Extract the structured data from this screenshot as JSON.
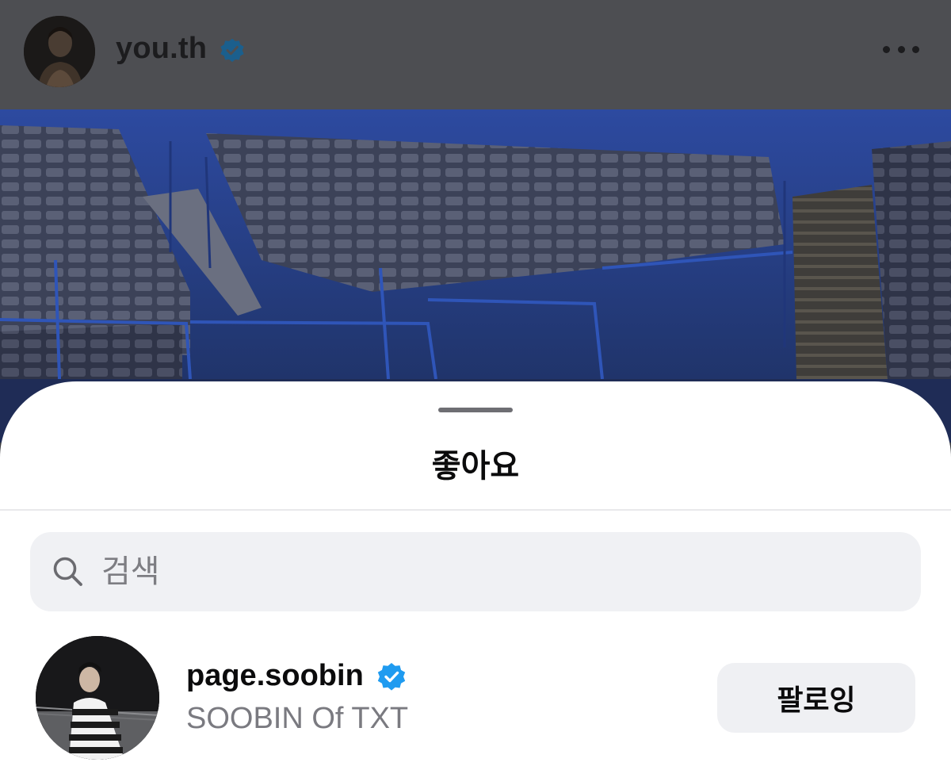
{
  "post": {
    "username": "you.th",
    "verified_icon": "verified-badge-icon",
    "more_icon": "more-horizontal-icon"
  },
  "sheet": {
    "title": "좋아요",
    "search": {
      "placeholder": "검색",
      "value": ""
    },
    "items": [
      {
        "username": "page.soobin",
        "full_name": "SOOBIN Of TXT",
        "verified": true,
        "button_label": "팔로잉"
      }
    ]
  },
  "colors": {
    "verified_blue": "#1f9bf0",
    "dim_overlay": "#4d4e52",
    "sheet_bg": "#ffffff",
    "search_bg": "#f0f1f4"
  }
}
